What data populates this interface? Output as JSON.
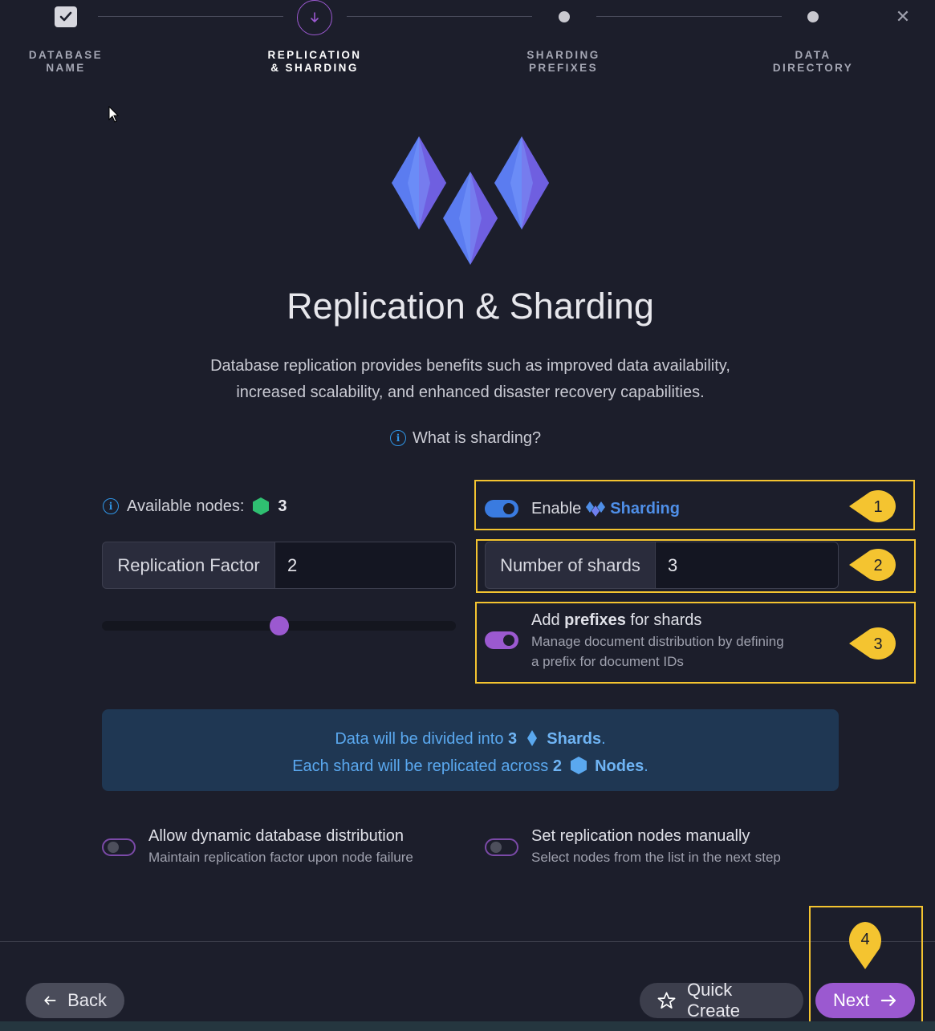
{
  "stepper": {
    "steps": [
      {
        "label": "DATABASE\nNAME",
        "state": "done"
      },
      {
        "label": "REPLICATION\n& SHARDING",
        "state": "current"
      },
      {
        "label": "SHARDING\nPREFIXES",
        "state": "pending"
      },
      {
        "label": "DATA\nDIRECTORY",
        "state": "pending"
      }
    ],
    "close_icon": "close-icon"
  },
  "hero": {
    "title": "Replication & Sharding",
    "description_line1": "Database replication provides benefits such as improved data availability,",
    "description_line2": "increased scalability, and enhanced disaster recovery capabilities.",
    "what_is_sharding": "What is sharding?"
  },
  "replication": {
    "available_nodes_label": "Available nodes:",
    "available_nodes_count": "3",
    "factor_label": "Replication Factor",
    "factor_value": "2",
    "slider_fraction": 0.5
  },
  "sharding": {
    "enable_label": "Enable",
    "sharding_word": "Sharding",
    "enabled": true,
    "shards_label": "Number of shards",
    "shards_value": "3",
    "prefixes_title_pre": "Add ",
    "prefixes_title_bold": "prefixes",
    "prefixes_title_post": " for shards",
    "prefixes_sub_line1": "Manage document distribution by defining",
    "prefixes_sub_line2": "a prefix for document IDs",
    "prefixes_enabled": true
  },
  "callouts": [
    "1",
    "2",
    "3",
    "4"
  ],
  "info_panel": {
    "line1_pre": "Data will be divided into ",
    "line1_num": "3",
    "line1_word": "Shards",
    "line1_end": ".",
    "line2_pre": "Each shard will be replicated across ",
    "line2_num": "2",
    "line2_word": "Nodes",
    "line2_end": "."
  },
  "options": {
    "dynamic_title": "Allow dynamic database distribution",
    "dynamic_sub": "Maintain replication factor upon node failure",
    "dynamic_enabled": false,
    "manual_title": "Set replication nodes manually",
    "manual_sub": "Select nodes from the list in the next step",
    "manual_enabled": false
  },
  "footer": {
    "back_label": "Back",
    "quick_create_label": "Quick Create",
    "next_label": "Next"
  },
  "colors": {
    "accent_purple": "#9b59d0",
    "accent_blue": "#3a7be0",
    "highlight_yellow": "#f4c430",
    "node_green": "#2fbf71",
    "background": "#1c1e2b"
  }
}
